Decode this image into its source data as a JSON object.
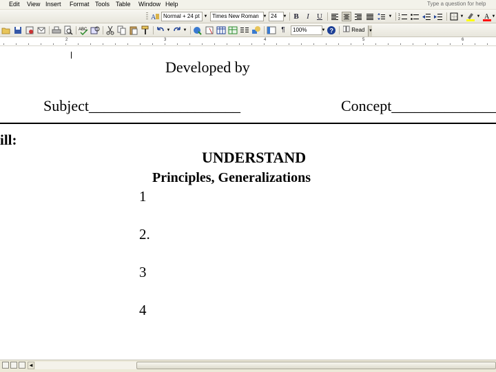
{
  "menubar": {
    "items": [
      "Edit",
      "View",
      "Insert",
      "Format",
      "Tools",
      "Table",
      "Window",
      "Help"
    ],
    "help_placeholder": "Type a question for help"
  },
  "formatting_toolbar": {
    "style": "Normal + 24 pt",
    "font": "Times New Roman",
    "size": "24",
    "bold": "B",
    "italic": "I",
    "underline": "U"
  },
  "standard_toolbar": {
    "zoom": "100%",
    "read_label": "Read",
    "pilcrow": "¶"
  },
  "ruler": {
    "numbers": [
      "2",
      "3",
      "4",
      "5",
      "6"
    ]
  },
  "document": {
    "developed_by": "Developed by",
    "subject": "Subject____________________",
    "concept": "Concept______________",
    "skill": "ill:",
    "understand": "UNDERSTAND",
    "principles": "Principles, Generalizations",
    "items": [
      "1",
      "2.",
      "3",
      "4"
    ]
  },
  "colors": {
    "chrome": "#ece9d8",
    "document": "#ffffff",
    "text": "#000000"
  }
}
